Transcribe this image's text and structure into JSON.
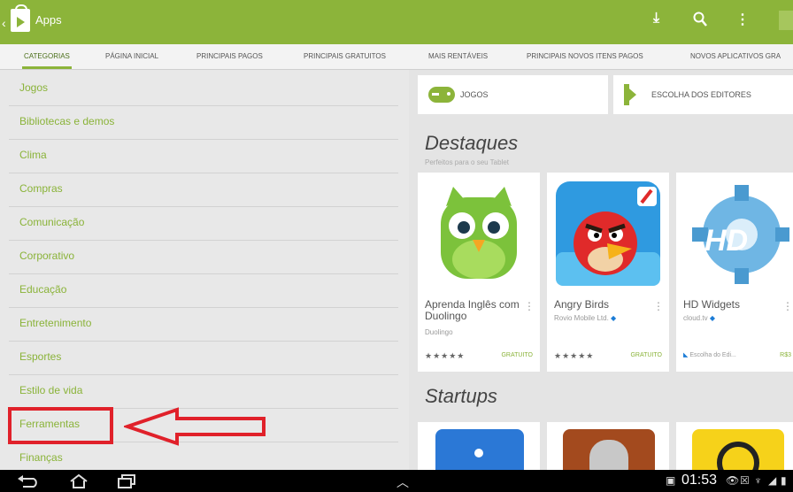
{
  "header": {
    "title": "Apps"
  },
  "tabs": [
    {
      "label": "CATEGORIAS"
    },
    {
      "label": "PÁGINA INICIAL"
    },
    {
      "label": "PRINCIPAIS PAGOS"
    },
    {
      "label": "PRINCIPAIS GRATUITOS"
    },
    {
      "label": "MAIS RENTÁVEIS"
    },
    {
      "label": "PRINCIPAIS NOVOS ITENS PAGOS"
    },
    {
      "label": "NOVOS APLICATIVOS GRA"
    }
  ],
  "categories": [
    {
      "label": "Jogos"
    },
    {
      "label": "Bibliotecas e demos"
    },
    {
      "label": "Clima"
    },
    {
      "label": "Compras"
    },
    {
      "label": "Comunicação"
    },
    {
      "label": "Corporativo"
    },
    {
      "label": "Educação"
    },
    {
      "label": "Entretenimento"
    },
    {
      "label": "Esportes"
    },
    {
      "label": "Estilo de vida"
    },
    {
      "label": "Ferramentas"
    },
    {
      "label": "Finanças"
    }
  ],
  "shortcuts": {
    "games": "JOGOS",
    "editors": "ESCOLHA DOS EDITORES"
  },
  "featured": {
    "title": "Destaques",
    "subtitle": "Perfeitos para o seu Tablet",
    "apps": [
      {
        "name": "Aprenda Inglês com Duolingo",
        "developer": "Duolingo",
        "rating": "★★★★★",
        "price": "GRATUITO"
      },
      {
        "name": "Angry Birds",
        "developer": "Rovio Mobile Ltd.",
        "rating": "★★★★★",
        "price": "GRATUITO"
      },
      {
        "name": "HD Widgets",
        "developer": "cloud.tv",
        "editors_tag": "Escolha do Edi...",
        "price": "R$3"
      }
    ]
  },
  "startups": {
    "title": "Startups"
  },
  "status_bar": {
    "time": "01:53"
  },
  "colors": {
    "accent": "#8cb43a",
    "highlight": "#e0212a"
  }
}
